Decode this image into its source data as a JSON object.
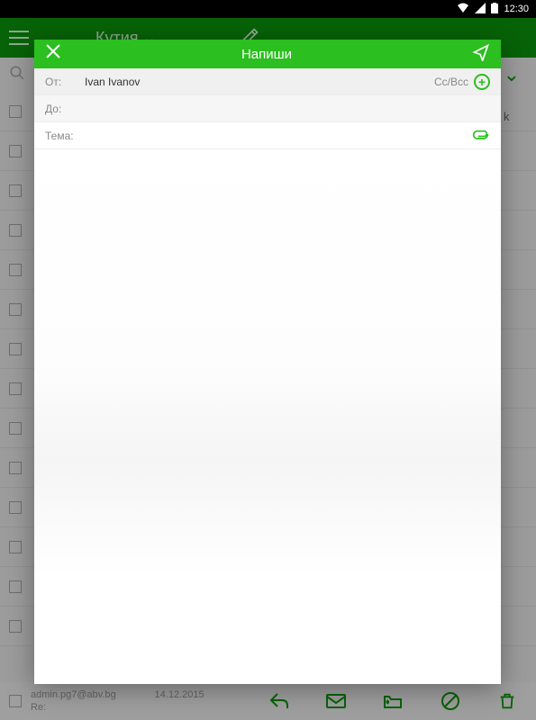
{
  "status": {
    "time": "12:30"
  },
  "bg": {
    "folder": "Кутия",
    "footer_sender": "admin.pg7@abv.bg",
    "footer_date": "14.12.2015",
    "footer_subject": "Re:"
  },
  "compose": {
    "title": "Напиши",
    "from_label": "От:",
    "from_value": "Ivan Ivanov",
    "ccbcc_label": "Cc/Bcc",
    "to_label": "До:",
    "subject_label": "Тема:"
  },
  "peek": {
    "text": "k"
  },
  "colors": {
    "brand": "#2bbf1f",
    "header_dark": "#0a8a0a"
  }
}
